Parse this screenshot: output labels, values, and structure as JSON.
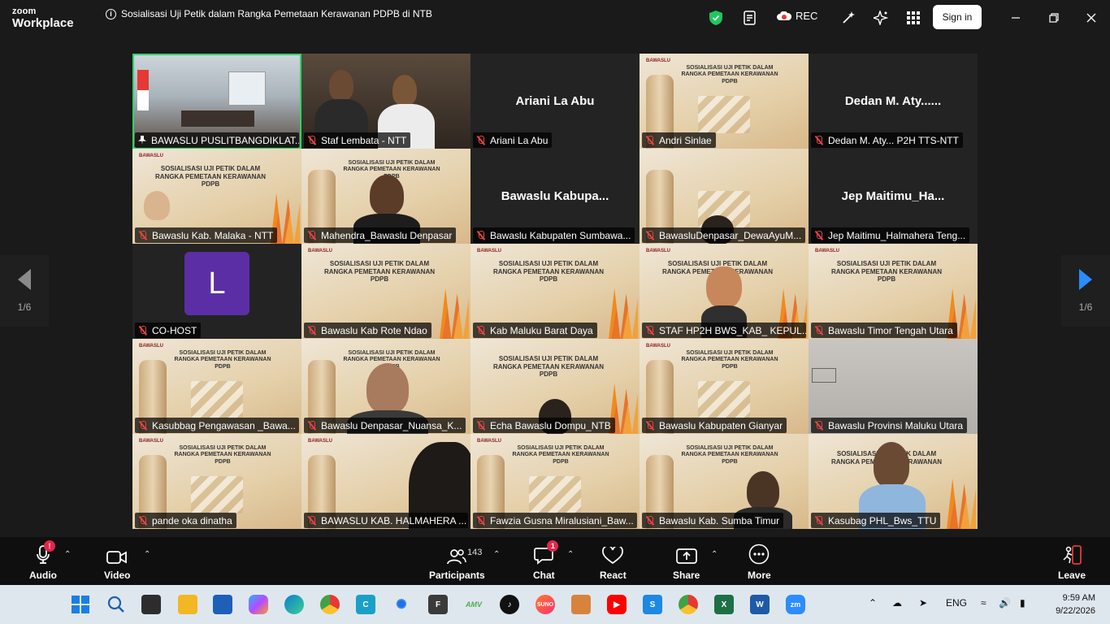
{
  "titlebar": {
    "brand_top": "zoom",
    "brand_bottom": "Workplace",
    "meeting_title": "Sosialisasi Uji Petik dalam Rangka Pemetaan Kerawanan PDPB di NTB",
    "rec_label": "REC",
    "signin_label": "Sign in"
  },
  "gallery": {
    "page_indicator_left": "1/6",
    "page_indicator_right": "1/6",
    "tiles": [
      {
        "label": "BAWASLU PUSLITBANGDIKLAT...",
        "display_name": ""
      },
      {
        "label": "Staf Lembata - NTT",
        "display_name": ""
      },
      {
        "label": "Ariani La Abu",
        "display_name": "Ariani La Abu"
      },
      {
        "label": "Andri Sinlae",
        "display_name": ""
      },
      {
        "label": "Dedan M. Aty... P2H TTS-NTT",
        "display_name": "Dedan M. Aty......"
      },
      {
        "label": "Bawaslu Kab. Malaka - NTT",
        "display_name": ""
      },
      {
        "label": "Mahendra_Bawaslu Denpasar",
        "display_name": ""
      },
      {
        "label": "Bawaslu Kabupaten Sumbawa...",
        "display_name": "Bawaslu  Kabupa..."
      },
      {
        "label": "BawasluDenpasar_DewaAyuM...",
        "display_name": ""
      },
      {
        "label": "Jep Maitimu_Halmahera Teng...",
        "display_name": "Jep  Maitimu_Ha..."
      },
      {
        "label": "CO-HOST",
        "display_name": "",
        "avatar_letter": "L"
      },
      {
        "label": "Bawaslu Kab Rote Ndao",
        "display_name": ""
      },
      {
        "label": "Kab Maluku Barat Daya",
        "display_name": ""
      },
      {
        "label": "STAF HP2H BWS_KAB_ KEPUL...",
        "display_name": ""
      },
      {
        "label": "Bawaslu Timor Tengah Utara",
        "display_name": ""
      },
      {
        "label": "Kasubbag Pengawasan _Bawa...",
        "display_name": ""
      },
      {
        "label": "Bawaslu Denpasar_Nuansa_K...",
        "display_name": ""
      },
      {
        "label": "Echa Bawaslu Dompu_NTB",
        "display_name": ""
      },
      {
        "label": "Bawaslu Kabupaten Gianyar",
        "display_name": ""
      },
      {
        "label": "Bawaslu Provinsi Maluku Utara",
        "display_name": ""
      },
      {
        "label": "pande oka dinatha",
        "display_name": ""
      },
      {
        "label": "BAWASLU KAB. HALMAHERA ...",
        "display_name": ""
      },
      {
        "label": "Fawzia Gusna Miralusiani_Baw...",
        "display_name": ""
      },
      {
        "label": "Bawaslu Kab. Sumba Timur",
        "display_name": ""
      },
      {
        "label": "Kasubag PHL_Bws_TTU",
        "display_name": ""
      }
    ],
    "slide_text": {
      "logo": "BAWASLU",
      "title": "SOSIALISASI UJI PETIK DALAM RANGKA PEMETAAN KERAWANAN PDPB"
    }
  },
  "toolbar": {
    "audio": "Audio",
    "audio_badge": "!",
    "video": "Video",
    "participants": "Participants",
    "participants_count": "143",
    "chat": "Chat",
    "chat_badge": "1",
    "react": "React",
    "share": "Share",
    "more": "More",
    "leave": "Leave"
  },
  "taskbar": {
    "lang": "ENG",
    "time": "9:59 AM",
    "date": "9/22/2026"
  },
  "colors": {
    "accent_green": "#2fd46b",
    "badge_red": "#e5254a",
    "avatar_purple": "#5b2ea6",
    "arrow_blue": "#2b8cff"
  }
}
